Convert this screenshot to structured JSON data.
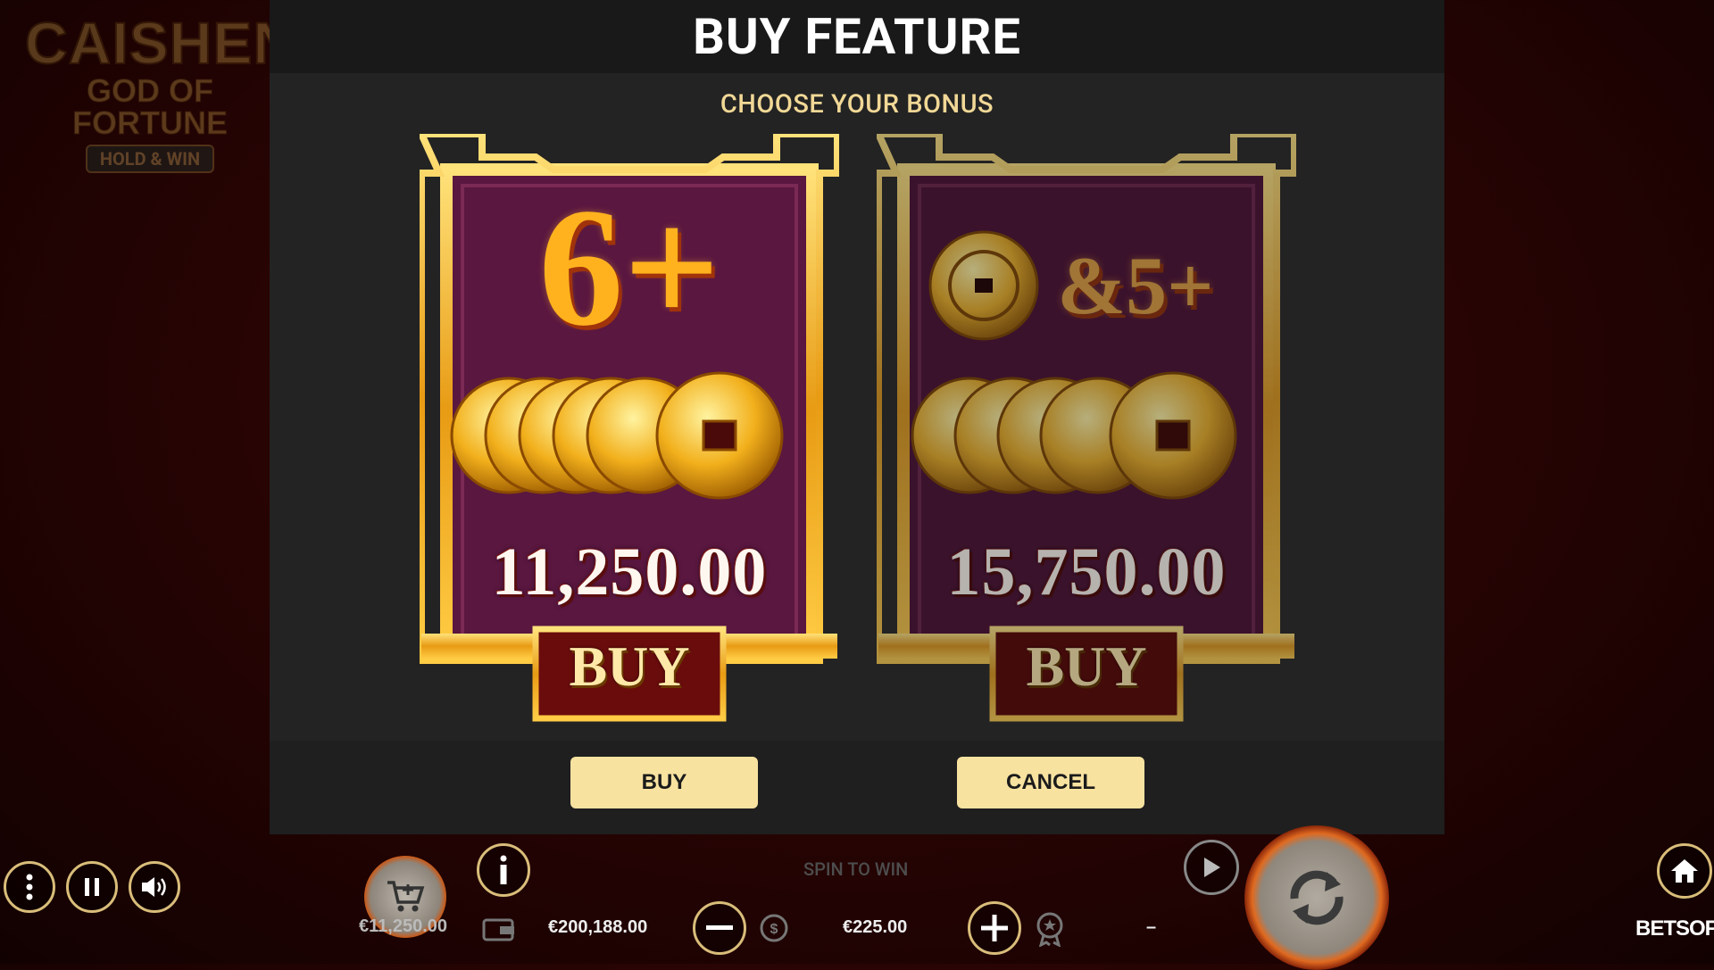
{
  "game": {
    "logo_line1": "CAISHEN",
    "logo_line2": "GOD OF FORTUNE",
    "logo_line3": "HOLD & WIN"
  },
  "modal": {
    "title": "BUY FEATURE",
    "subtitle": "CHOOSE YOUR BONUS",
    "buy_button": "BUY",
    "cancel_button": "CANCEL"
  },
  "options": [
    {
      "head": "6+",
      "amount": "11,250.00",
      "buy_label": "BUY",
      "selected": true
    },
    {
      "head": "&5+",
      "amount": "15,750.00",
      "buy_label": "BUY",
      "selected": false
    }
  ],
  "bottom": {
    "buy_feature_price": "€11,250.00",
    "balance": "€200,188.00",
    "bet": "€225.00",
    "win": "–",
    "status": "SPIN TO WIN",
    "brand": "BETSOFT"
  },
  "colors": {
    "accent": "#f8e2a0",
    "gold": "#d9bd7a",
    "card_bg": "#5a1740",
    "modal_bg": "#232323"
  }
}
